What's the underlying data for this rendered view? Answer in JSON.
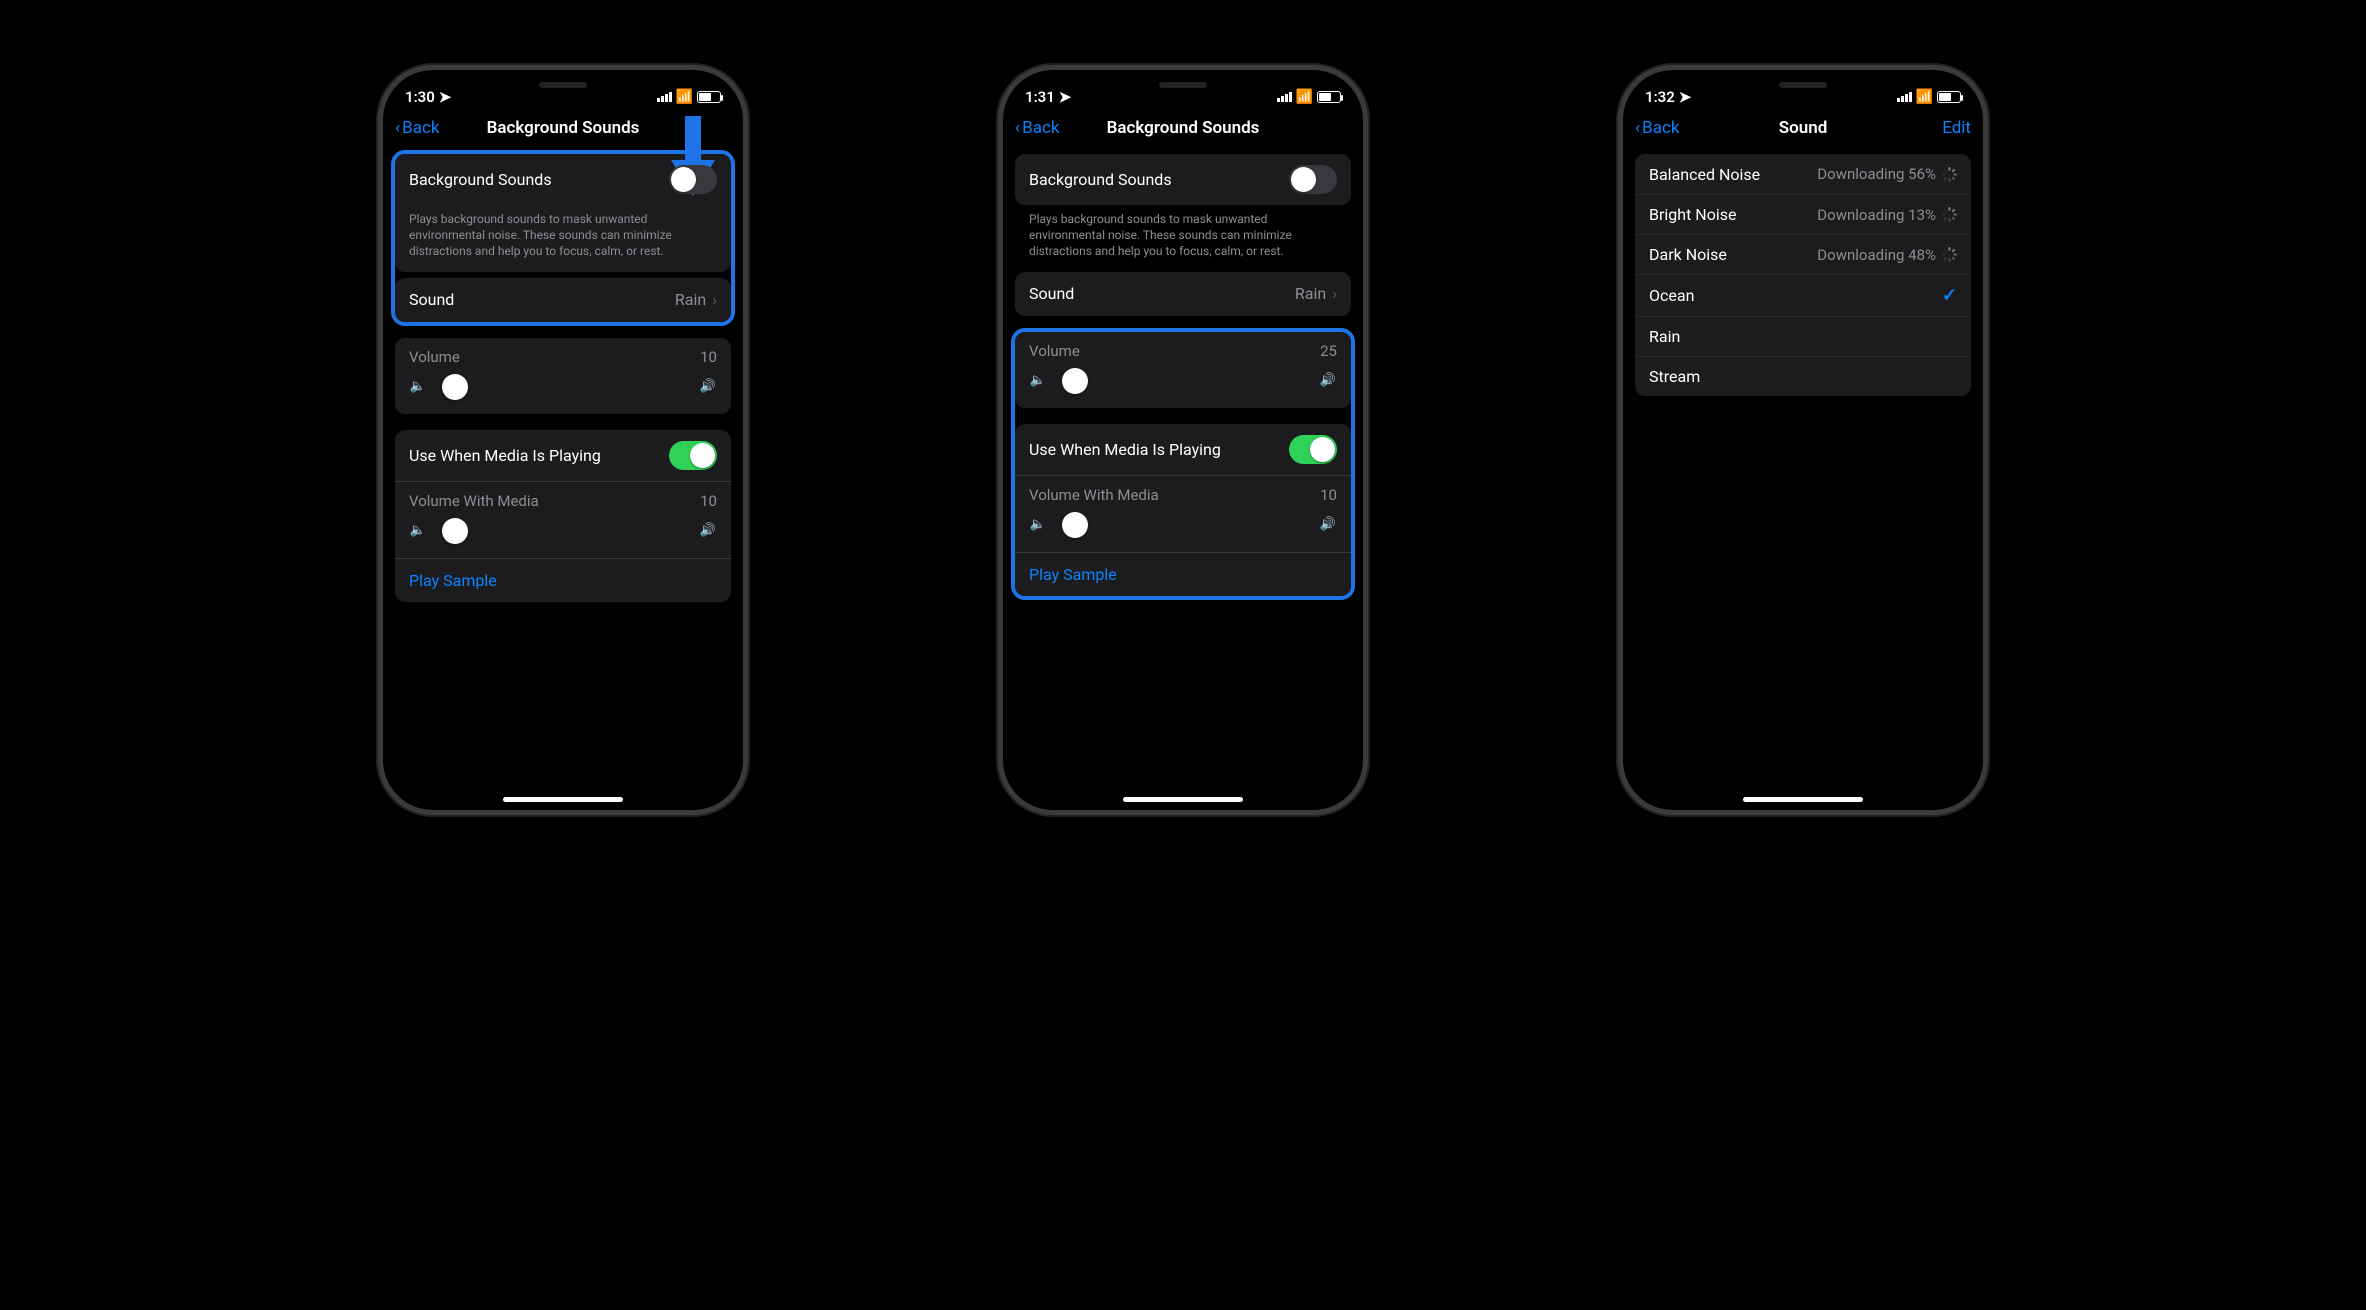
{
  "phones": [
    {
      "status_time": "1:30",
      "nav_back": "Back",
      "nav_title": "Background Sounds",
      "bg_sounds_label": "Background Sounds",
      "bg_sounds_on": false,
      "footer": "Plays background sounds to mask unwanted environmental noise. These sounds can minimize distractions and help you to focus, calm, or rest.",
      "sound_label": "Sound",
      "sound_value": "Rain",
      "volume_label": "Volume",
      "volume_value": "10",
      "volume_pct": 10,
      "media_label": "Use When Media Is Playing",
      "media_on": true,
      "volume_media_label": "Volume With Media",
      "volume_media_value": "10",
      "volume_media_pct": 10,
      "play_sample": "Play Sample",
      "highlight_top": true,
      "highlight_bottom": false,
      "arrow": true
    },
    {
      "status_time": "1:31",
      "nav_back": "Back",
      "nav_title": "Background Sounds",
      "bg_sounds_label": "Background Sounds",
      "bg_sounds_on": false,
      "footer": "Plays background sounds to mask unwanted environmental noise. These sounds can minimize distractions and help you to focus, calm, or rest.",
      "sound_label": "Sound",
      "sound_value": "Rain",
      "volume_label": "Volume",
      "volume_value": "25",
      "volume_pct": 25,
      "media_label": "Use When Media Is Playing",
      "media_on": true,
      "volume_media_label": "Volume With Media",
      "volume_media_value": "10",
      "volume_media_pct": 10,
      "play_sample": "Play Sample",
      "highlight_top": false,
      "highlight_bottom": true,
      "arrow": false
    }
  ],
  "phone3": {
    "status_time": "1:32",
    "nav_back": "Back",
    "nav_title": "Sound",
    "nav_edit": "Edit",
    "sounds": [
      {
        "name": "Balanced Noise",
        "status": "Downloading 56%",
        "downloading": true,
        "selected": false
      },
      {
        "name": "Bright Noise",
        "status": "Downloading 13%",
        "downloading": true,
        "selected": false
      },
      {
        "name": "Dark Noise",
        "status": "Downloading 48%",
        "downloading": true,
        "selected": false
      },
      {
        "name": "Ocean",
        "status": "",
        "downloading": false,
        "selected": true
      },
      {
        "name": "Rain",
        "status": "",
        "downloading": false,
        "selected": false
      },
      {
        "name": "Stream",
        "status": "",
        "downloading": false,
        "selected": false
      }
    ]
  }
}
